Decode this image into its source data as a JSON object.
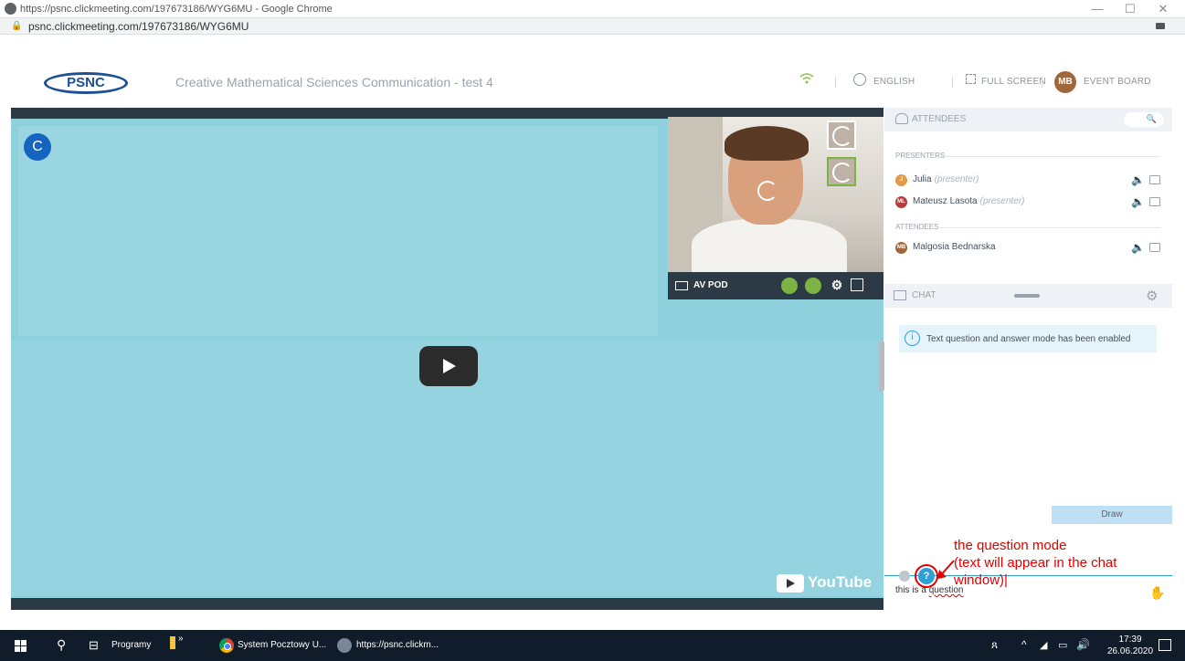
{
  "window": {
    "title": "https://psnc.clickmeeting.com/197673186/WYG6MU - Google Chrome",
    "url": "psnc.clickmeeting.com/197673186/WYG6MU",
    "controls": {
      "minimize": "—",
      "maximize": "☐",
      "close": "✕"
    }
  },
  "header": {
    "logo_text": "PSNC",
    "event_title": "Creative Mathematical Sciences Communication - test 4",
    "language": "ENGLISH",
    "fullscreen": "FULL SCREEN",
    "avatar_initials": "MB",
    "event_board": "EVENT BOARD"
  },
  "stage": {
    "badge": "C",
    "youtube_label": "YouTube"
  },
  "webcam": {
    "label": "AV POD"
  },
  "attendees": {
    "title": "ATTENDEES",
    "presenters_label": "PRESENTERS",
    "attendees_label": "ATTENDEES",
    "presenters": [
      {
        "initials": "J",
        "name": "Julia",
        "role": "(presenter)",
        "color": "#e29a4b"
      },
      {
        "initials": "ML",
        "name": "Mateusz Lasota",
        "role": "(presenter)",
        "color": "#b83a3a"
      }
    ],
    "people": [
      {
        "initials": "MB",
        "name": "Malgosia Bednarska",
        "role": "",
        "color": "#a0683a"
      }
    ]
  },
  "chat": {
    "title": "CHAT",
    "notice": "Text question and answer mode has been enabled",
    "draw_button": "Draw",
    "input_prefix": "this is a ",
    "input_word": "question"
  },
  "annotation": {
    "line1": "the question mode",
    "line2": "(text will appear in the chat",
    "line3": "window)|"
  },
  "taskbar": {
    "programs": "Programy",
    "more": "»",
    "app1": "System Pocztowy U...",
    "app2": "https://psnc.clickm...",
    "time": "17:39",
    "date": "26.06.2020"
  },
  "colors": {
    "accent_green": "#7cb342",
    "accent_blue": "#2f9fd8",
    "annotation_red": "#e00000",
    "stage_blue": "#8fd0dd"
  }
}
